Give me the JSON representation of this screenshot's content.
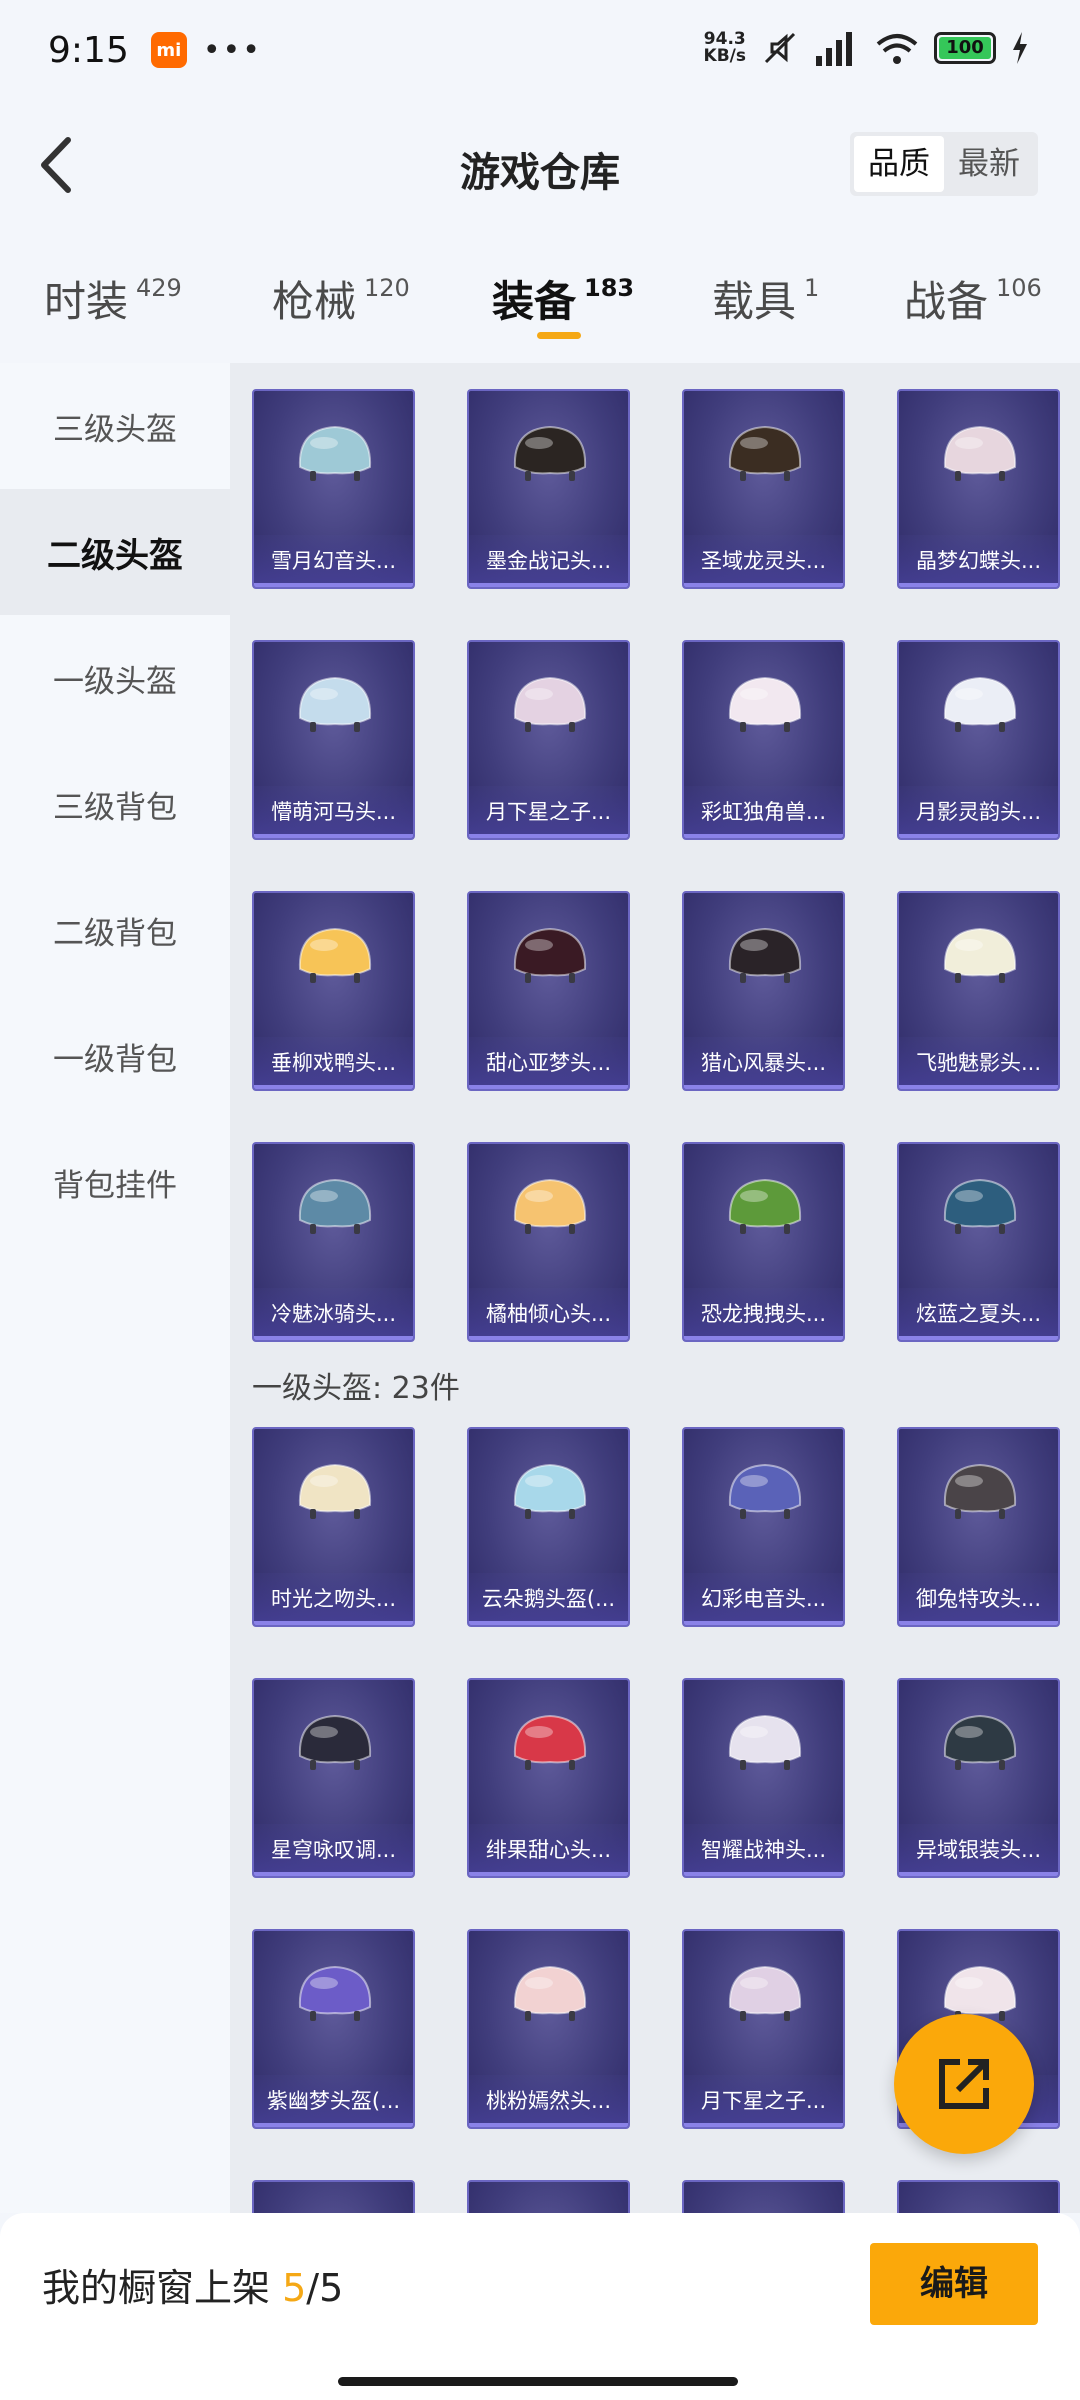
{
  "status": {
    "time": "9:15",
    "speed_top": "94.3",
    "speed_bottom": "KB/s",
    "battery": "100"
  },
  "header": {
    "title": "游戏仓库",
    "sort_quality": "品质",
    "sort_latest": "最新"
  },
  "tabs": [
    {
      "label": "时装",
      "count": "429"
    },
    {
      "label": "枪械",
      "count": "120"
    },
    {
      "label": "装备",
      "count": "183"
    },
    {
      "label": "载具",
      "count": "1"
    },
    {
      "label": "战备",
      "count": "106"
    }
  ],
  "sidebar": [
    {
      "label": "三级头盔"
    },
    {
      "label": "二级头盔"
    },
    {
      "label": "一级头盔"
    },
    {
      "label": "三级背包"
    },
    {
      "label": "二级背包"
    },
    {
      "label": "一级背包"
    },
    {
      "label": "背包挂件"
    }
  ],
  "section_label": "一级头盔: 23件",
  "items": [
    {
      "name": "雪月幻音头...",
      "color": "#9ec9d6"
    },
    {
      "name": "墨金战记头...",
      "color": "#2b2522"
    },
    {
      "name": "圣域龙灵头...",
      "color": "#3b2d22"
    },
    {
      "name": "晶梦幻蝶头...",
      "color": "#e7d6de"
    },
    {
      "name": "懵萌河马头...",
      "color": "#c4dcec"
    },
    {
      "name": "月下星之子...",
      "color": "#e4d2e2"
    },
    {
      "name": "彩虹独角兽...",
      "color": "#f2e8f0"
    },
    {
      "name": "月影灵韵头...",
      "color": "#ebeef6"
    },
    {
      "name": "垂柳戏鸭头...",
      "color": "#f7c457"
    },
    {
      "name": "甜心亚梦头...",
      "color": "#3a1a24"
    },
    {
      "name": "猎心风暴头...",
      "color": "#2a2328"
    },
    {
      "name": "飞驰魅影头...",
      "color": "#f1eeda"
    },
    {
      "name": "冷魅冰骑头...",
      "color": "#5d8aa6"
    },
    {
      "name": "橘柚倾心头...",
      "color": "#f6c370"
    },
    {
      "name": "恐龙拽拽头...",
      "color": "#5d9a3a"
    },
    {
      "name": "炫蓝之夏头...",
      "color": "#2d5e7e"
    },
    {
      "name": "时光之吻头...",
      "color": "#f0e4c4"
    },
    {
      "name": "云朵鹅头盔(...",
      "color": "#a8d8ea"
    },
    {
      "name": "幻彩电音头...",
      "color": "#5a62b8"
    },
    {
      "name": "御兔特攻头...",
      "color": "#4a4448"
    },
    {
      "name": "星穹咏叹调...",
      "color": "#2a2a3a"
    },
    {
      "name": "绯果甜心头...",
      "color": "#d83848"
    },
    {
      "name": "智耀战神头...",
      "color": "#e6e2ee"
    },
    {
      "name": "异域银装头...",
      "color": "#2e3a44"
    },
    {
      "name": "紫幽梦头盔(...",
      "color": "#6c5cc8"
    },
    {
      "name": "桃粉嫣然头...",
      "color": "#f2d2d2"
    },
    {
      "name": "月下星之子...",
      "color": "#e0d0e4"
    },
    {
      "name": "",
      "color": "#f0e4ea"
    }
  ],
  "bottom": {
    "showcase_prefix": "我的橱窗上架 ",
    "showcase_current": "5",
    "showcase_total": "/5",
    "edit": "编辑"
  },
  "colors": {
    "accent": "#fba80a",
    "card": "#403d7c"
  }
}
